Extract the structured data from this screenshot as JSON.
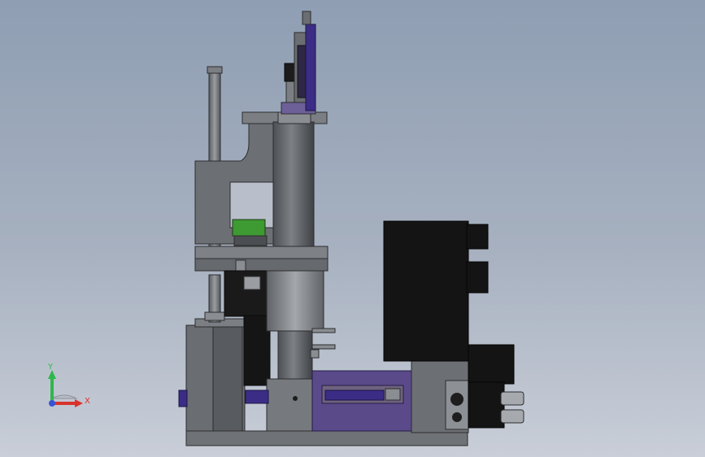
{
  "viewport": {
    "background_top": "#8f9eb3",
    "background_bottom": "#c9ced8"
  },
  "triad": {
    "y_label": "Y",
    "x_label": "X",
    "y_color": "#2fb84a",
    "x_color": "#d9332b",
    "z_color": "#3a53d6"
  },
  "model": {
    "part_colors": {
      "body": "#6f7276",
      "dark": "#3c3e41",
      "black": "#141414",
      "green": "#3e9a33",
      "purple": "#5a4a8a",
      "violet": "#3b2d86",
      "light": "#8d9094"
    }
  }
}
